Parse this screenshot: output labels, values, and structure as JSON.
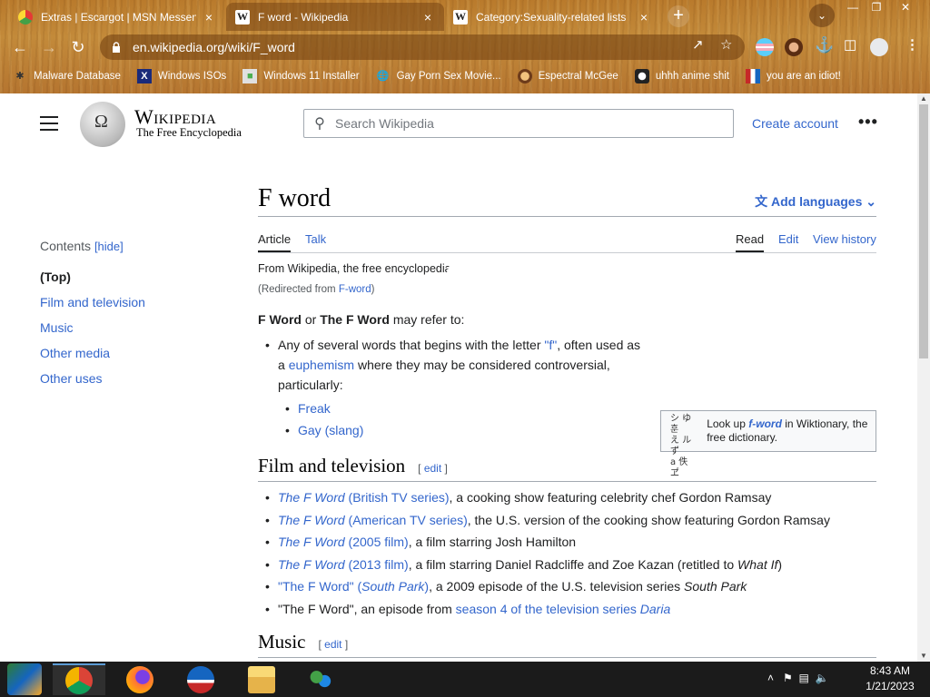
{
  "browser": {
    "tabs": [
      {
        "title": "Extras | Escargot | MSN Messen",
        "active": false
      },
      {
        "title": "F word - Wikipedia",
        "active": true
      },
      {
        "title": "Category:Sexuality-related lists",
        "active": false
      }
    ],
    "tab_close": "×",
    "new_tab": "+",
    "url": "en.wikipedia.org/wiki/F_word",
    "bookmarks": [
      {
        "label": "Malware Database",
        "icon": "bug-icon"
      },
      {
        "label": "Windows ISOs",
        "icon": "x-icon"
      },
      {
        "label": "Windows 11 Installer",
        "icon": "image-icon"
      },
      {
        "label": "Gay Porn Sex Movie...",
        "icon": "globe-icon"
      },
      {
        "label": "Espectral McGee",
        "icon": "face-icon"
      },
      {
        "label": "uhhh anime shit",
        "icon": "anime-icon"
      },
      {
        "label": "you are an idiot!",
        "icon": "flag-icon"
      }
    ]
  },
  "wiki": {
    "wordmark": "Wikipedia",
    "tagline": "The Free Encyclopedia",
    "search_placeholder": "Search Wikipedia",
    "create_account": "Create account",
    "more": "•••",
    "toc": {
      "heading": "Contents",
      "hide": "[hide]",
      "items": [
        "(Top)",
        "Film and television",
        "Music",
        "Other media",
        "Other uses"
      ]
    },
    "title": "F word",
    "add_languages": "Add languages",
    "tabs": {
      "article": "Article",
      "talk": "Talk",
      "read": "Read",
      "edit": "Edit",
      "history": "View history"
    },
    "from": "From Wikipedia, the free encyclopedia",
    "redirect_prefix": "(Redirected from ",
    "redirect_link": "F-word",
    "redirect_suffix": ")",
    "wiktionary": {
      "pre": "Look up ",
      "word": "f-word",
      "post": " in Wiktionary, the free dictionary."
    },
    "lead": {
      "b1": "F Word",
      "or": " or ",
      "b2": "The F Word",
      "rest": " may refer to:"
    },
    "lead_item": {
      "t1": "Any of several words that begins with the letter ",
      "f": "\"f\"",
      "t2": ", often used as a ",
      "euph": "euphemism",
      "t3": " where they may be considered controversial, particularly:"
    },
    "sub_items": [
      "Freak",
      "Gay (slang)"
    ],
    "section1": {
      "heading": "Film and television",
      "edit": "edit",
      "items": [
        {
          "link_i": "The F Word",
          "link": " (British TV series)",
          "rest": ", a cooking show featuring celebrity chef Gordon Ramsay"
        },
        {
          "link_i": "The F Word",
          "link": " (American TV series)",
          "rest": ", the U.S. version of the cooking show featuring Gordon Ramsay"
        },
        {
          "link_i": "The F Word",
          "link": " (2005 film)",
          "rest": ", a film starring Josh Hamilton"
        },
        {
          "link_i": "The F Word",
          "link": " (2013 film)",
          "rest": ", a film starring Daniel Radcliffe and Zoe Kazan (retitled to ",
          "ital": "What If",
          "end": ")"
        }
      ],
      "item5": {
        "a": "\"The F Word\" (",
        "ai": "South Park",
        "b": ")",
        "rest": ", a 2009 episode of the U.S. television series ",
        "ri": "South Park"
      },
      "item6": {
        "pre": "\"The F Word\", an episode from ",
        "link": "season 4 of the television series ",
        "li": "Daria"
      }
    },
    "section2": {
      "heading": "Music",
      "edit": "edit"
    }
  },
  "taskbar": {
    "time": "8:43 AM",
    "date": "1/21/2023"
  },
  "colors": {
    "link": "#3366cc",
    "text": "#202122",
    "chrome": "#b97a2c"
  }
}
